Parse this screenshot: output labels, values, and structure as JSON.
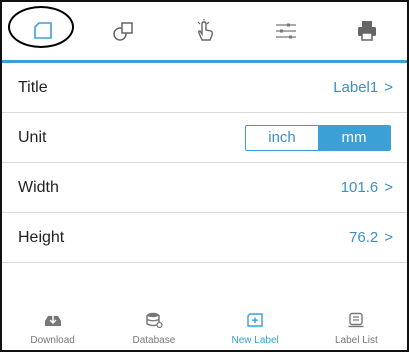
{
  "toolbar": {
    "items": [
      {
        "icon": "label-shape-icon",
        "selected": true
      },
      {
        "icon": "shapes-icon"
      },
      {
        "icon": "touch-hand-icon"
      },
      {
        "icon": "sliders-icon"
      },
      {
        "icon": "printer-icon"
      }
    ],
    "accent": "#3aa0d6"
  },
  "settings": {
    "title_label": "Title",
    "title_value": "Label1",
    "unit_label": "Unit",
    "unit_options": [
      "inch",
      "mm"
    ],
    "unit_selected": "mm",
    "width_label": "Width",
    "width_value": "101.6",
    "height_label": "Height",
    "height_value": "76.2",
    "chevron": ">"
  },
  "bottom_nav": {
    "items": [
      {
        "label": "Download",
        "icon": "download-icon"
      },
      {
        "label": "Database",
        "icon": "database-icon"
      },
      {
        "label": "New Label",
        "icon": "new-label-icon",
        "active": true
      },
      {
        "label": "Label List",
        "icon": "label-list-icon"
      }
    ]
  }
}
